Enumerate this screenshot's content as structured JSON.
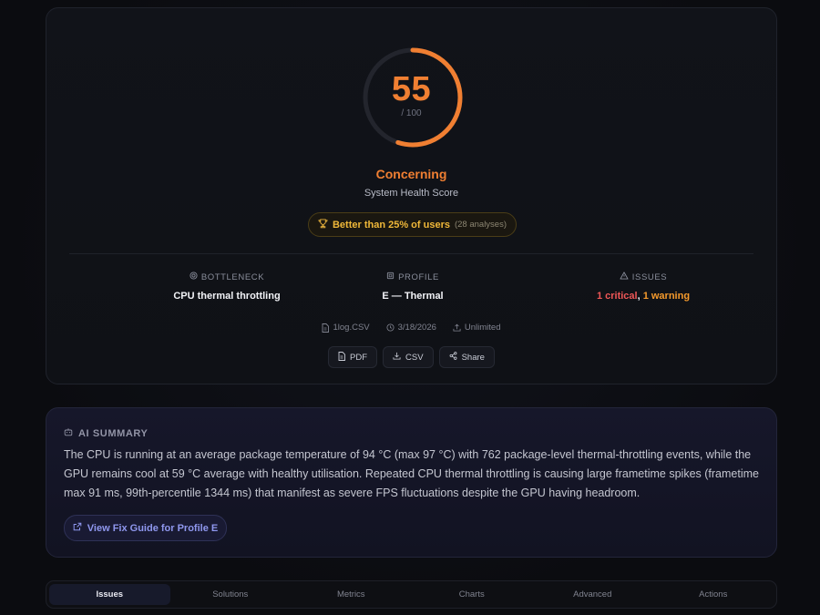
{
  "score": {
    "value": "55",
    "max_label": "/ 100",
    "fraction": 0.55,
    "verdict": "Concerning",
    "subtitle": "System Health Score",
    "color": "#f07f32"
  },
  "rank": {
    "text": "Better than 25% of users",
    "count": "(28 analyses)"
  },
  "stats": {
    "bottleneck": {
      "label": "BOTTLENECK",
      "value": "CPU thermal throttling"
    },
    "profile": {
      "label": "PROFILE",
      "value": "E — Thermal"
    },
    "issues": {
      "label": "ISSUES",
      "critical": "1 critical",
      "separator": ",",
      "warning": "1 warning"
    }
  },
  "meta": {
    "file": "1log.CSV",
    "date": "3/18/2026",
    "plan": "Unlimited"
  },
  "actions": {
    "pdf": "PDF",
    "csv": "CSV",
    "share": "Share"
  },
  "summary": {
    "title": "AI SUMMARY",
    "text": "The CPU is running at an average package temperature of 94 °C (max 97 °C) with 762 package-level thermal-throttling events, while the GPU remains cool at 59 °C average with healthy utilisation. Repeated CPU thermal throttling is causing large frametime spikes (frametime max 91 ms, 99th-percentile 1344 ms) that manifest as severe FPS fluctuations despite the GPU having headroom.",
    "guide_button": "View Fix Guide for Profile E"
  },
  "tabs": [
    "Issues",
    "Solutions",
    "Metrics",
    "Charts",
    "Advanced",
    "Actions"
  ],
  "active_tab": "Issues",
  "icons": {
    "bottleneck": "cpu-chip-icon",
    "profile": "profile-chip-icon",
    "issues": "warning-triangle-icon",
    "file": "file-icon",
    "date": "clock-icon",
    "plan": "upload-icon",
    "pdf": "document-icon",
    "csv": "download-icon",
    "share": "share-icon",
    "summary": "robot-icon",
    "guide": "external-link-icon",
    "rank": "trophy-icon"
  }
}
